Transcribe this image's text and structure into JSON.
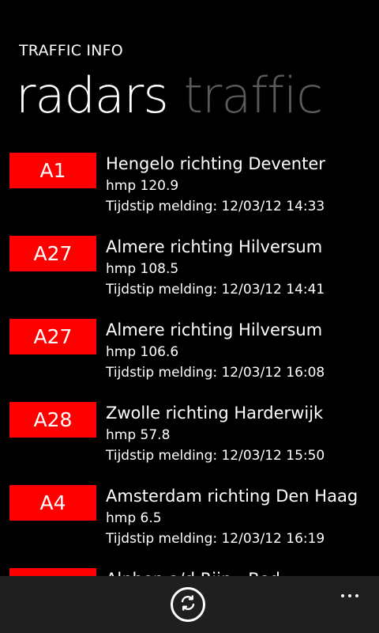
{
  "app": {
    "title": "TRAFFIC INFO"
  },
  "pivot": {
    "active": "radars",
    "inactive": "traffic"
  },
  "radars": [
    {
      "road": "A1",
      "route": "Hengelo richting Deventer",
      "hmp": "hmp 120.9",
      "time": "Tijdstip melding: 12/03/12 14:33"
    },
    {
      "road": "A27",
      "route": "Almere richting Hilversum",
      "hmp": "hmp 108.5",
      "time": "Tijdstip melding: 12/03/12 14:41"
    },
    {
      "road": "A27",
      "route": "Almere richting Hilversum",
      "hmp": "hmp 106.6",
      "time": "Tijdstip melding: 12/03/12 16:08"
    },
    {
      "road": "A28",
      "route": "Zwolle richting Harderwijk",
      "hmp": "hmp 57.8",
      "time": "Tijdstip melding: 12/03/12 15:50"
    },
    {
      "road": "A4",
      "route": "Amsterdam richting Den Haag",
      "hmp": "hmp 6.5",
      "time": "Tijdstip melding: 12/03/12 16:19"
    },
    {
      "road": "",
      "route": "Alphen a/d Rijn - Bod...",
      "hmp": "",
      "time": ""
    }
  ],
  "appbar": {
    "refresh_icon": "refresh-icon",
    "more_icon": "more-icon"
  },
  "colors": {
    "badge": "#ff0000",
    "background": "#000000",
    "inactive_pivot": "#5a5a5a",
    "appbar": "#1f1f1f"
  }
}
